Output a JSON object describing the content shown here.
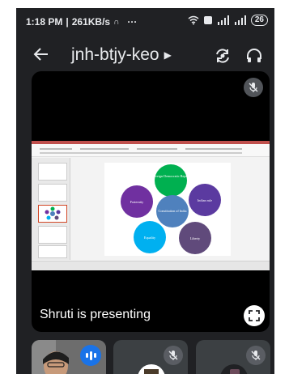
{
  "status_bar": {
    "time": "1:18 PM",
    "speed": "261KB/s",
    "extra": "···",
    "battery": "26"
  },
  "app_bar": {
    "meeting_code": "jnh-btjy-keo"
  },
  "presentation": {
    "label": "Shruti is presenting",
    "slide": {
      "center": "Constitution of India",
      "bubbles": [
        "Sovereign Democratic Republic",
        "Indian rule",
        "Liberty",
        "Equality",
        "Fraternity"
      ]
    }
  },
  "colors": {
    "background": "#202124",
    "accent": "#1a73e8",
    "tile": "#3c4043"
  }
}
